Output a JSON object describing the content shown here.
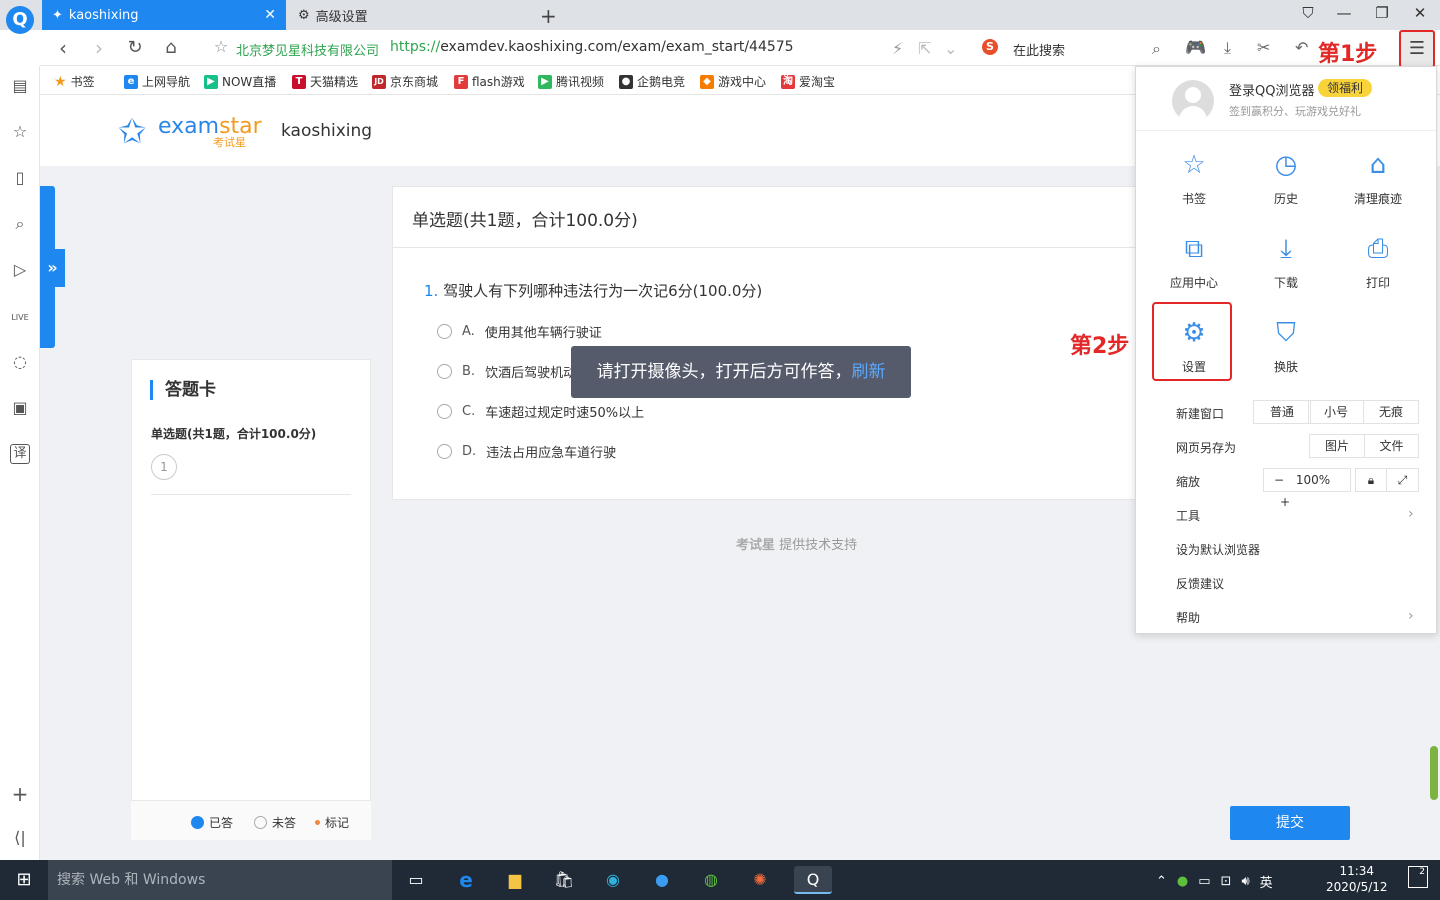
{
  "browser": {
    "tabs": [
      {
        "title": "kaoshixing",
        "active": true
      },
      {
        "title": "高级设置",
        "active": false
      }
    ],
    "security_label": "北京梦见星科技有限公司",
    "url_scheme": "https://",
    "url_rest": "examdev.kaoshixing.com/exam/exam_start/44575",
    "search_placeholder": "在此搜索",
    "step1_label": "第1步",
    "bookmarks": [
      {
        "label": "书签",
        "icon": "star-icon",
        "color": "#f39a1e"
      },
      {
        "label": "上网导航",
        "icon": "e-icon",
        "color": "#1e87f0"
      },
      {
        "label": "NOW直播",
        "icon": "now-icon",
        "color": "#16c08a"
      },
      {
        "label": "天猫精选",
        "icon": "tmall-icon",
        "color": "#c8102e"
      },
      {
        "label": "京东商城",
        "icon": "jd-icon",
        "color": "#c0272d"
      },
      {
        "label": "flash游戏",
        "icon": "flash-icon",
        "color": "#e23b3b"
      },
      {
        "label": "腾讯视频",
        "icon": "video-icon",
        "color": "#2fb85e"
      },
      {
        "label": "企鹅电竞",
        "icon": "penguin-icon",
        "color": "#333333"
      },
      {
        "label": "游戏中心",
        "icon": "gamepad-icon",
        "color": "#f57c00"
      },
      {
        "label": "爱淘宝",
        "icon": "taobao-icon",
        "color": "#e4393c"
      }
    ]
  },
  "page": {
    "brand_main": "exam",
    "brand_accent": "star",
    "brand_sub": "考试星",
    "org_name": "kaoshixing",
    "answer_card": {
      "title": "答题卡",
      "section": "单选题(共1题，合计100.0分)",
      "numbers": [
        "1"
      ],
      "legend": [
        {
          "label": "已答",
          "icon": "filled-dot-icon",
          "color": "#1e87f0"
        },
        {
          "label": "未答",
          "icon": "empty-dot-icon",
          "color": "#aaaaaa"
        },
        {
          "label": "标记",
          "icon": "small-dot-icon",
          "color": "#f0883e"
        }
      ]
    },
    "question_section": "单选题(共1题，合计100.0分)",
    "question": {
      "number": "1.",
      "text": "驾驶人有下列哪种违法行为一次记6分(100.0分)",
      "options": [
        {
          "letter": "A.",
          "text": "使用其他车辆行驶证"
        },
        {
          "letter": "B.",
          "text": "饮酒后驾驶机动车"
        },
        {
          "letter": "C.",
          "text": "车速超过规定时速50%以上"
        },
        {
          "letter": "D.",
          "text": "违法占用应急车道行驶"
        }
      ]
    },
    "toast_text": "请打开摄像头，打开后方可作答，",
    "toast_link": "刷新",
    "support_bold": "考试星",
    "support_text": " 提供技术支持",
    "submit_label": "提交"
  },
  "menu": {
    "login": "登录QQ浏览器",
    "benefit": "领福利",
    "login_sub": "签到赢积分、玩游戏兑好礼",
    "grid": [
      {
        "label": "书签",
        "icon": "star-outline-icon"
      },
      {
        "label": "历史",
        "icon": "clock-icon"
      },
      {
        "label": "清理痕迹",
        "icon": "broom-icon"
      },
      {
        "label": "应用中心",
        "icon": "puzzle-icon"
      },
      {
        "label": "下载",
        "icon": "download-icon"
      },
      {
        "label": "打印",
        "icon": "printer-icon"
      },
      {
        "label": "设置",
        "icon": "gear-icon"
      },
      {
        "label": "换肤",
        "icon": "shirt-icon"
      }
    ],
    "step2_label": "第2步",
    "new_window": {
      "label": "新建窗口",
      "options": [
        "普通",
        "小号",
        "无痕"
      ]
    },
    "save_as": {
      "label": "网页另存为",
      "options": [
        "图片",
        "文件"
      ]
    },
    "zoom": {
      "label": "缩放",
      "minus": "−",
      "value": "100%",
      "plus": "+"
    },
    "tools": "工具",
    "default_browser": "设为默认浏览器",
    "feedback": "反馈建议",
    "help": "帮助"
  },
  "taskbar": {
    "search_placeholder": "搜索 Web 和 Windows",
    "ime": "英",
    "time": "11:34",
    "date": "2020/5/12",
    "notification_count": "2"
  }
}
